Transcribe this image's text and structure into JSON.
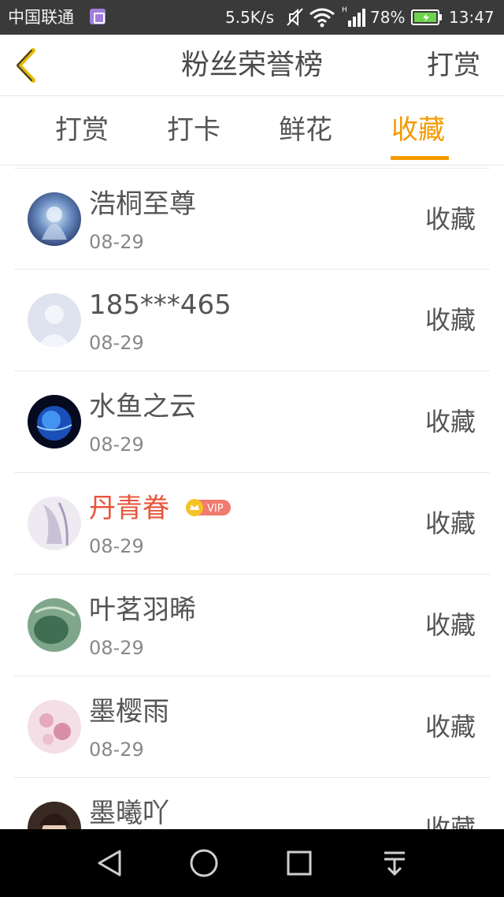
{
  "status_bar": {
    "carrier": "中国联通",
    "net_speed": "5.5K/s",
    "battery_pct": "78%",
    "time": "13:47"
  },
  "header": {
    "title": "粉丝荣誉榜",
    "action": "打赏"
  },
  "tabs": [
    {
      "label": "打赏",
      "active": false
    },
    {
      "label": "打卡",
      "active": false
    },
    {
      "label": "鲜花",
      "active": false
    },
    {
      "label": "收藏",
      "active": true
    }
  ],
  "list": [
    {
      "name": "浩桐至尊",
      "date": "08-29",
      "action": "收藏",
      "vip": false
    },
    {
      "name": "185***465",
      "date": "08-29",
      "action": "收藏",
      "vip": false
    },
    {
      "name": "水鱼之云",
      "date": "08-29",
      "action": "收藏",
      "vip": false
    },
    {
      "name": "丹青眷",
      "date": "08-29",
      "action": "收藏",
      "vip": true,
      "badge": "VIP"
    },
    {
      "name": "叶茗羽晞",
      "date": "08-29",
      "action": "收藏",
      "vip": false
    },
    {
      "name": "墨樱雨",
      "date": "08-29",
      "action": "收藏",
      "vip": false
    },
    {
      "name": "墨曦吖",
      "date": "",
      "action": "收藏",
      "vip": false
    }
  ],
  "colors": {
    "accent": "#f39a00",
    "vip_name": "#e8543a",
    "status_bar_bg": "#3a3a3a"
  },
  "icons": [
    "back-icon",
    "sound-off-icon",
    "wifi-icon",
    "signal-icon",
    "battery-icon",
    "nav-back-icon",
    "nav-home-icon",
    "nav-recent-icon",
    "nav-menu-icon"
  ]
}
